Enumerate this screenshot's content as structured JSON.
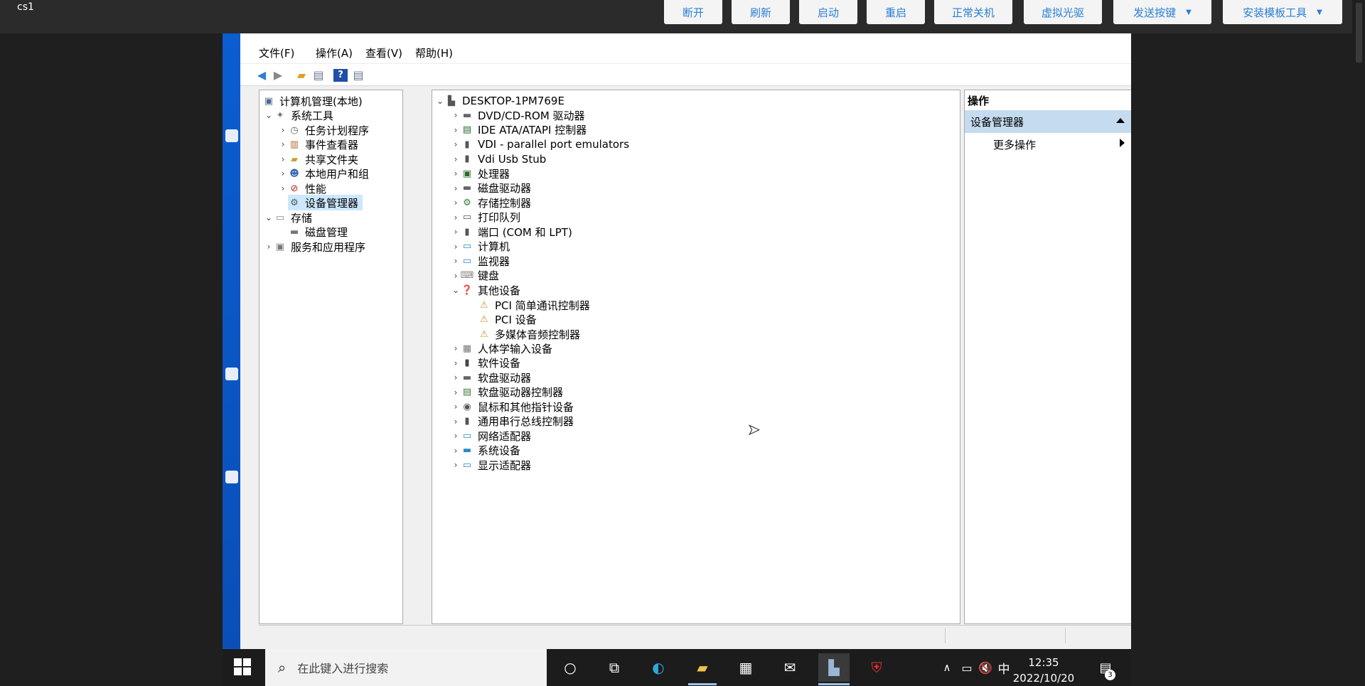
{
  "viewer": {
    "vm_name": "cs1",
    "buttons": [
      {
        "label": "断开"
      },
      {
        "label": "刷新"
      },
      {
        "label": "启动"
      },
      {
        "label": "重启"
      },
      {
        "label": "正常关机"
      },
      {
        "label": "虚拟光驱"
      },
      {
        "label": "发送按键"
      },
      {
        "label": "安装模板工具"
      }
    ]
  },
  "menubar": {
    "items": [
      "文件(F)",
      "操作(A)",
      "查看(V)",
      "帮助(H)"
    ]
  },
  "toolbar": {
    "icons": [
      "back-arrow-icon",
      "forward-arrow-icon",
      "up-folder-icon",
      "show-hide-tree-icon",
      "help-icon",
      "properties-icon"
    ]
  },
  "tree": {
    "root": "计算机管理(本地)",
    "system_tools": "系统工具",
    "items": [
      "任务计划程序",
      "事件查看器",
      "共享文件夹",
      "本地用户和组",
      "性能",
      "设备管理器"
    ],
    "storage": "存储",
    "disk_management": "磁盘管理",
    "services": "服务和应用程序"
  },
  "devices": {
    "computer": "DESKTOP-1PM769E",
    "categories_before": [
      "DVD/CD-ROM 驱动器",
      "IDE ATA/ATAPI 控制器",
      "VDI - parallel port emulators",
      "Vdi Usb Stub",
      "处理器",
      "磁盘驱动器",
      "存储控制器",
      "打印队列",
      "端口 (COM 和 LPT)",
      "计算机",
      "监视器",
      "键盘"
    ],
    "other_devices": "其他设备",
    "other_children": [
      "PCI 简单通讯控制器",
      "PCI 设备",
      "多媒体音频控制器"
    ],
    "categories_after": [
      "人体学输入设备",
      "软件设备",
      "软盘驱动器",
      "软盘驱动器控制器",
      "鼠标和其他指针设备",
      "通用串行总线控制器",
      "网络适配器",
      "系统设备",
      "显示适配器"
    ]
  },
  "actions": {
    "title": "操作",
    "group": "设备管理器",
    "more": "更多操作"
  },
  "taskbar": {
    "search_placeholder": "在此键入进行搜索",
    "ime": "中",
    "time": "12:35",
    "date": "2022/10/20",
    "notification_count": "3"
  },
  "colors": {
    "accent_button_text": "#2a7fd4",
    "desktop_blue": "#0a58ca",
    "selection": "#cce8ff",
    "action_group": "#c5dbef"
  }
}
